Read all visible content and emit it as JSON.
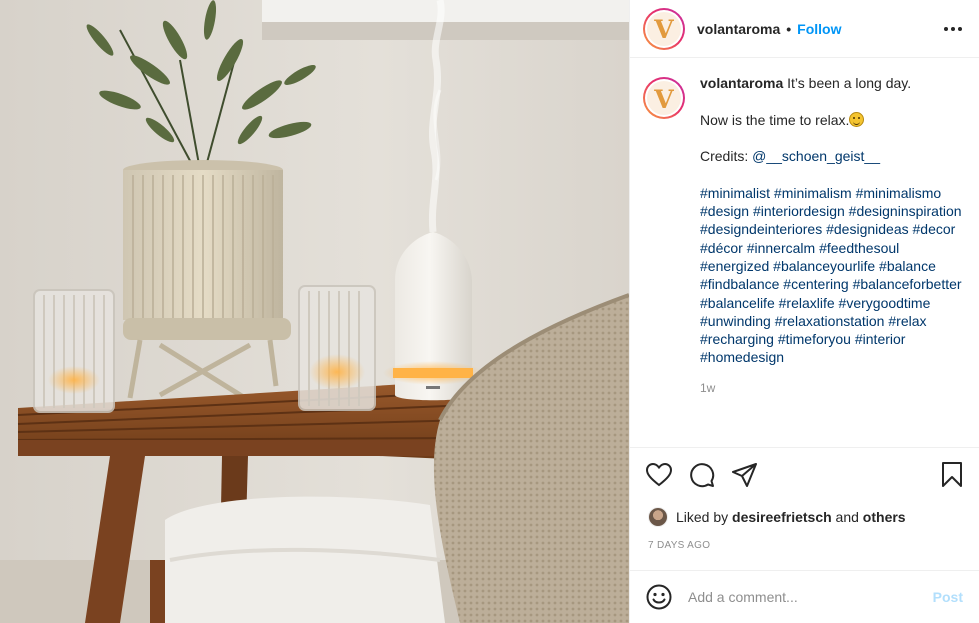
{
  "post": {
    "username": "volantaroma",
    "header_dot": "•",
    "follow_label": "Follow",
    "avatar_letter": "V",
    "caption": {
      "line1": "It’s been a long day.",
      "line2": "Now is the time to relax.",
      "emoji_icon": "grinning-face-emoji",
      "credits_label": "Credits:",
      "credits_handle": "@__schoen_geist__",
      "hashtags": [
        "#minimalist",
        "#minimalism",
        "#minimalismo",
        "#design",
        "#interiordesign",
        "#designinspiration",
        "#designdeinteriores",
        "#designideas",
        "#decor",
        "#décor",
        "#innercalm",
        "#feedthesoul",
        "#energized",
        "#balanceyourlife",
        "#balance",
        "#findbalance",
        "#centering",
        "#balanceforbetter",
        "#balancelife",
        "#relaxlife",
        "#verygoodtime",
        "#unwinding",
        "#relaxationstation",
        "#relax",
        "#recharging",
        "#timeforyou",
        "#interior",
        "#homedesign"
      ]
    },
    "time_ago": "1w",
    "likes": {
      "prefix": "Liked by",
      "user": "desireefrietsch",
      "conjunction": "and",
      "others": "others"
    },
    "date": "7 DAYS AGO",
    "comment": {
      "placeholder": "Add a comment...",
      "post_label": "Post"
    },
    "icons": [
      "more-options-icon",
      "heart-icon",
      "comment-icon",
      "share-icon",
      "bookmark-icon",
      "smile-icon"
    ],
    "colors": {
      "link": "#00376b",
      "follow": "#0095f6",
      "post_disabled": "#b2dffc",
      "muted": "#8e8e8e",
      "brand_logo": "#e29a3d"
    }
  }
}
